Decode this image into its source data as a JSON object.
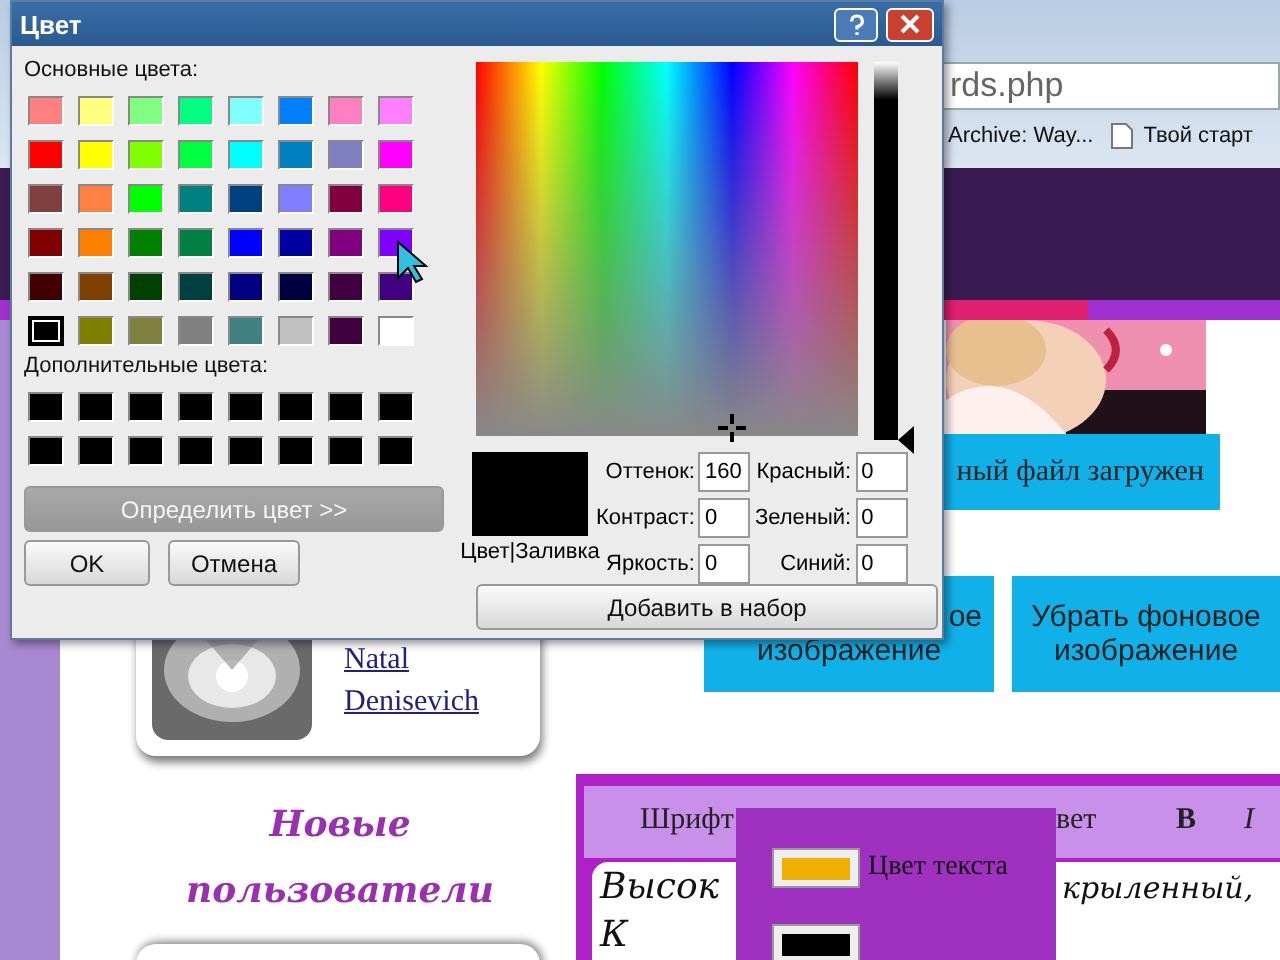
{
  "browser": {
    "address": "rds.php",
    "bookmarks": [
      {
        "label": "Archive: Way...",
        "kind": "text"
      },
      {
        "label": "Твой старт",
        "kind": "page"
      }
    ]
  },
  "page": {
    "upload_status": "ный файл загружен",
    "buttons": [
      {
        "lines": [
          "ое",
          "изображение"
        ]
      },
      {
        "lines": [
          "Убрать фоновое",
          "изображение"
        ]
      }
    ],
    "user_links": [
      "Natal",
      "Denisevich"
    ],
    "section_title": "Новые пользователи",
    "editor": {
      "toolbar": [
        {
          "label": "Шрифт",
          "kind": "text"
        },
        {
          "label": "вет",
          "kind": "text"
        },
        {
          "label": "B",
          "kind": "bold"
        },
        {
          "label": "I",
          "kind": "italic"
        }
      ],
      "text": [
        "Высок",
        "крыленный,",
        "К"
      ]
    },
    "color_menu": [
      {
        "label": "Цвет текста",
        "color": "#f0b000"
      },
      {
        "color": "#000000"
      }
    ]
  },
  "dialog": {
    "title": "Цвет",
    "basic_label": "Основные цвета:",
    "basic_colors": [
      {
        "color": "#ff8080",
        "selected": false
      },
      {
        "color": "#ffff80",
        "selected": false
      },
      {
        "color": "#80ff80",
        "selected": false
      },
      {
        "color": "#00ff80",
        "selected": false
      },
      {
        "color": "#80ffff",
        "selected": false
      },
      {
        "color": "#0080ff",
        "selected": false
      },
      {
        "color": "#ff80c0",
        "selected": false
      },
      {
        "color": "#ff80ff",
        "selected": false
      },
      {
        "color": "#ff0000",
        "selected": false
      },
      {
        "color": "#ffff00",
        "selected": false
      },
      {
        "color": "#80ff00",
        "selected": false
      },
      {
        "color": "#00ff40",
        "selected": false
      },
      {
        "color": "#00ffff",
        "selected": false
      },
      {
        "color": "#0080c0",
        "selected": false
      },
      {
        "color": "#8080c0",
        "selected": false
      },
      {
        "color": "#ff00ff",
        "selected": false
      },
      {
        "color": "#804040",
        "selected": false
      },
      {
        "color": "#ff8040",
        "selected": false
      },
      {
        "color": "#00ff00",
        "selected": false
      },
      {
        "color": "#008080",
        "selected": false
      },
      {
        "color": "#004080",
        "selected": false
      },
      {
        "color": "#8080ff",
        "selected": false
      },
      {
        "color": "#800040",
        "selected": false
      },
      {
        "color": "#ff0080",
        "selected": false
      },
      {
        "color": "#800000",
        "selected": false
      },
      {
        "color": "#ff8000",
        "selected": false
      },
      {
        "color": "#008000",
        "selected": false
      },
      {
        "color": "#008040",
        "selected": false
      },
      {
        "color": "#0000ff",
        "selected": false
      },
      {
        "color": "#0000a0",
        "selected": false
      },
      {
        "color": "#800080",
        "selected": false
      },
      {
        "color": "#8000ff",
        "selected": false
      },
      {
        "color": "#400000",
        "selected": false
      },
      {
        "color": "#804000",
        "selected": false
      },
      {
        "color": "#004000",
        "selected": false
      },
      {
        "color": "#004040",
        "selected": false
      },
      {
        "color": "#000080",
        "selected": false
      },
      {
        "color": "#000040",
        "selected": false
      },
      {
        "color": "#400040",
        "selected": false
      },
      {
        "color": "#400080",
        "selected": false
      },
      {
        "color": "#000000",
        "selected": true
      },
      {
        "color": "#808000",
        "selected": false
      },
      {
        "color": "#808040",
        "selected": false
      },
      {
        "color": "#808080",
        "selected": false
      },
      {
        "color": "#408080",
        "selected": false
      },
      {
        "color": "#c0c0c0",
        "selected": false
      },
      {
        "color": "#400040",
        "selected": false
      },
      {
        "color": "#ffffff",
        "selected": false
      }
    ],
    "custom_label": "Дополнительные цвета:",
    "custom_colors": [
      {
        "color": "#000000"
      },
      {
        "color": "#000000"
      },
      {
        "color": "#000000"
      },
      {
        "color": "#000000"
      },
      {
        "color": "#000000"
      },
      {
        "color": "#000000"
      },
      {
        "color": "#000000"
      },
      {
        "color": "#000000"
      },
      {
        "color": "#000000"
      },
      {
        "color": "#000000"
      },
      {
        "color": "#000000"
      },
      {
        "color": "#000000"
      },
      {
        "color": "#000000"
      },
      {
        "color": "#000000"
      },
      {
        "color": "#000000"
      },
      {
        "color": "#000000"
      }
    ],
    "luminance": {
      "level": 0
    },
    "define_button": {
      "label": "Определить цвет >>",
      "disabled": true
    },
    "ok": "OK",
    "cancel": "Отмена",
    "preview": {
      "color": "#000000"
    },
    "preview_label": "Цвет|Заливка",
    "fields_left": [
      {
        "label": "Оттенок:",
        "value": "160"
      },
      {
        "label": "Контраст:",
        "value": "0"
      },
      {
        "label": "Яркость:",
        "value": "0"
      }
    ],
    "fields_right": [
      {
        "label": "Красный:",
        "value": "0"
      },
      {
        "label": "Зеленый:",
        "value": "0"
      },
      {
        "label": "Синий:",
        "value": "0"
      }
    ],
    "add_button": "Добавить в набор"
  }
}
